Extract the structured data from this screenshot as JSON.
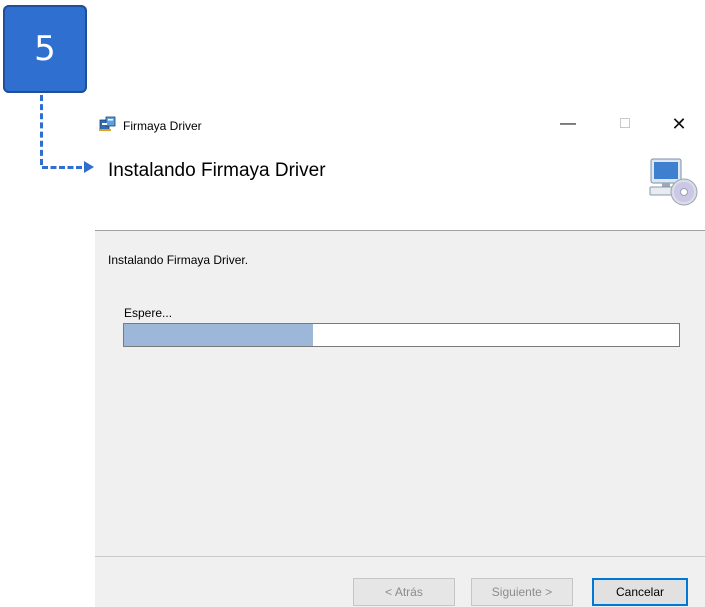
{
  "step": {
    "number": "5"
  },
  "window": {
    "title": "Firmaya Driver",
    "controls": {
      "minimize": "—",
      "maximize": "□",
      "close": "✕"
    }
  },
  "header": {
    "title": "Instalando Firmaya Driver"
  },
  "content": {
    "status": "Instalando Firmaya Driver.",
    "wait_label": "Espere...",
    "progress": 0.34
  },
  "buttons": {
    "back": "< Atrás",
    "next": "Siguiente >",
    "cancel": "Cancelar"
  },
  "colors": {
    "accent": "#2f6fcf",
    "progress_fill": "#9db7d9",
    "focus_border": "#0078d7"
  }
}
